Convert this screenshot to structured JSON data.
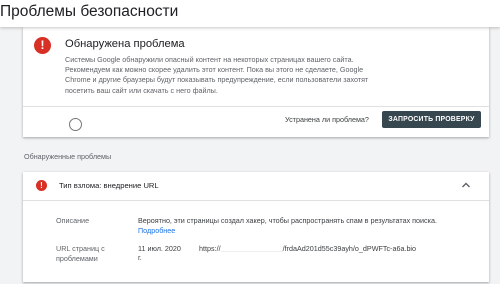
{
  "header": {
    "title": "Проблемы безопасности"
  },
  "alert": {
    "icon": "error-icon",
    "icon_glyph": "!",
    "title": "Обнаружена проблема",
    "body": "Системы Google обнаружили опасный контент на некоторых страницах вашего сайта. Рекомендуем как можно скорее удалить этот контент. Пока вы этого не сделаете, Google Chrome и другие браузеры будут показывать предупреждение, если пользователи захотят посетить ваш сайт или скачать с него файлы.",
    "resolved_question": "Устранена ли проблема?",
    "request_button": "ЗАПРОСИТЬ ПРОВЕРКУ"
  },
  "issues": {
    "section_label": "Обнаруженные проблемы",
    "item": {
      "icon": "error-icon",
      "icon_glyph": "!",
      "title": "Тип взлома: внедрение URL",
      "chevron": "chevron-up-icon",
      "description_label": "Описание",
      "description_text": "Вероятно, эти страницы создал хакер, чтобы распространять спам в результатах поиска.",
      "description_link": "Подробнее",
      "url_label": "URL страниц с проблемами",
      "url_date": "11 июл. 2020",
      "url_prefix": "https://",
      "url_suffix": "/frdaAd201d55c39ayh/o_dPWFTc-a6a.bio",
      "url_tail": "г."
    }
  },
  "colors": {
    "error": "#d93025",
    "button": "#37474f",
    "link": "#1a73e8",
    "background": "#f1f3f4"
  }
}
